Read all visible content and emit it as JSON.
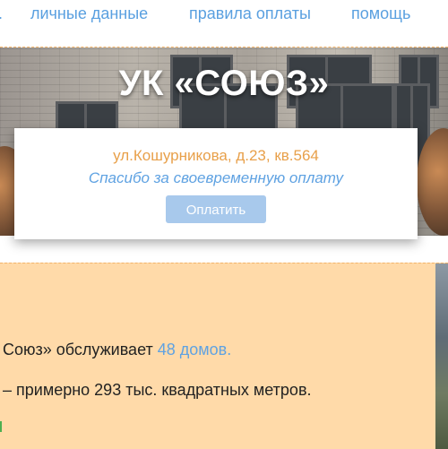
{
  "nav": {
    "items": [
      {
        "label": "..."
      },
      {
        "label": "личные данные"
      },
      {
        "label": "правила оплаты"
      },
      {
        "label": "помощь"
      }
    ]
  },
  "hero": {
    "title": "УК «СОЮЗ»"
  },
  "card": {
    "address": "ул.Кошурникова, д.23, кв.564",
    "thanks": "Спасибо за своевременную оплату",
    "pay_button": "Оплатить"
  },
  "info": {
    "line1_prefix": "Союз» обслуживает",
    "line1_link": "48 домов.",
    "line2": "– примерно 293 тыс. квадратных метров."
  },
  "colors": {
    "nav_link": "#5aa0e0",
    "address": "#e8a04a",
    "thanks": "#5fa2e2",
    "pay_button_bg": "#a8c9ec",
    "info_bg": "#ffdaa9"
  }
}
